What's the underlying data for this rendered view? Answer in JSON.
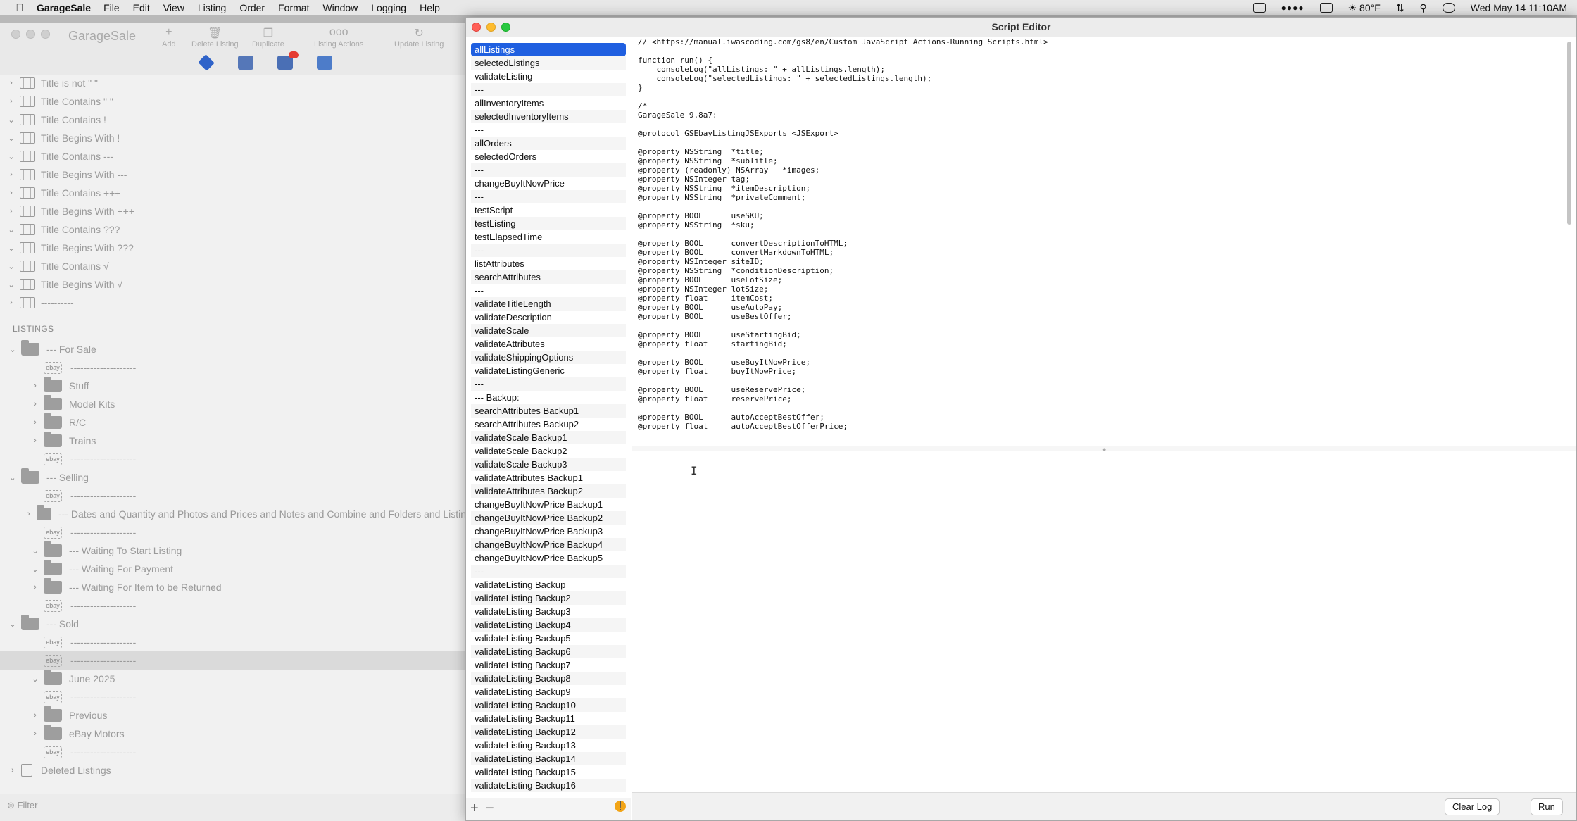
{
  "menubar": {
    "app_name": "GarageSale",
    "items": [
      "File",
      "Edit",
      "View",
      "Listing",
      "Order",
      "Format",
      "Window",
      "Logging",
      "Help"
    ],
    "weather": "80°F",
    "datetime": "Wed May 14 11:10AM"
  },
  "main": {
    "window_title": "GarageSale",
    "toolbar": {
      "add": "Add",
      "delete_listing": "Delete Listing",
      "duplicate": "Duplicate",
      "listing_actions": "Listing Actions",
      "update_listing": "Update Listing"
    },
    "smart_folders": [
      "Title is not \" \"",
      "Title Contains \" \"",
      "Title Contains !",
      "Title Begins With !",
      "Title Contains ---",
      "Title Begins With ---",
      "Title Contains +++",
      "Title Begins With +++",
      "Title Contains ???",
      "Title Begins With ???",
      "Title Contains √",
      "Title Begins With √",
      "----------"
    ],
    "section_listings": "LISTINGS",
    "listings": [
      {
        "label": "--- For Sale",
        "kind": "folder",
        "indent": 0
      },
      {
        "label": "--------------------",
        "kind": "ebay",
        "indent": 1
      },
      {
        "label": "Stuff",
        "kind": "folder",
        "indent": 1
      },
      {
        "label": "Model Kits",
        "kind": "folder",
        "indent": 1
      },
      {
        "label": "R/C",
        "kind": "folder",
        "indent": 1
      },
      {
        "label": "Trains",
        "kind": "folder",
        "indent": 1
      },
      {
        "label": "--------------------",
        "kind": "ebay",
        "indent": 1
      },
      {
        "label": "--- Selling",
        "kind": "folder",
        "indent": 0
      },
      {
        "label": "--------------------",
        "kind": "ebay",
        "indent": 1
      },
      {
        "label": "--- Dates and Quantity and Photos and Prices and Notes and Combine and Folders and Listin",
        "kind": "folder",
        "indent": 1
      },
      {
        "label": "--------------------",
        "kind": "ebay",
        "indent": 1
      },
      {
        "label": "--- Waiting To Start Listing",
        "kind": "folder",
        "indent": 1
      },
      {
        "label": "--- Waiting For Payment",
        "kind": "folder",
        "indent": 1
      },
      {
        "label": "--- Waiting For Item to be Returned",
        "kind": "folder",
        "indent": 1
      },
      {
        "label": "--------------------",
        "kind": "ebay",
        "indent": 1
      },
      {
        "label": "--- Sold",
        "kind": "folder",
        "indent": 0
      },
      {
        "label": "--------------------",
        "kind": "ebay",
        "indent": 1
      },
      {
        "label": "--------------------",
        "kind": "ebay",
        "indent": 1
      },
      {
        "label": "June 2025",
        "kind": "folder",
        "indent": 1
      },
      {
        "label": "--------------------",
        "kind": "ebay",
        "indent": 1
      },
      {
        "label": "Previous",
        "kind": "folder",
        "indent": 1
      },
      {
        "label": "eBay Motors",
        "kind": "folder",
        "indent": 1
      },
      {
        "label": "--------------------",
        "kind": "ebay",
        "indent": 1
      },
      {
        "label": "Deleted Listings",
        "kind": "trash",
        "indent": 0
      }
    ],
    "filter_placeholder": "Filter"
  },
  "editor": {
    "title": "Script Editor",
    "scripts": [
      "allListings",
      "selectedListings",
      "validateListing",
      "---",
      "allInventoryItems",
      "selectedInventoryItems",
      "---",
      "allOrders",
      "selectedOrders",
      "---",
      "changeBuyItNowPrice",
      "---",
      "testScript",
      "testListing",
      "testElapsedTime",
      "---",
      "listAttributes",
      "searchAttributes",
      "---",
      "validateTitleLength",
      "validateDescription",
      "validateScale",
      "validateAttributes",
      "validateShippingOptions",
      "validateListingGeneric",
      "---",
      "--- Backup:",
      "searchAttributes Backup1",
      "searchAttributes Backup2",
      "validateScale Backup1",
      "validateScale Backup2",
      "validateScale Backup3",
      "validateAttributes Backup1",
      "validateAttributes Backup2",
      "changeBuyItNowPrice Backup1",
      "changeBuyItNowPrice Backup2",
      "changeBuyItNowPrice Backup3",
      "changeBuyItNowPrice Backup4",
      "changeBuyItNowPrice Backup5",
      "---",
      "validateListing Backup",
      "validateListing Backup2",
      "validateListing Backup3",
      "validateListing Backup4",
      "validateListing Backup5",
      "validateListing Backup6",
      "validateListing Backup7",
      "validateListing Backup8",
      "validateListing Backup9",
      "validateListing Backup10",
      "validateListing Backup11",
      "validateListing Backup12",
      "validateListing Backup13",
      "validateListing Backup14",
      "validateListing Backup15",
      "validateListing Backup16"
    ],
    "code_lines": [
      "// <https://manual.iwascoding.com/gs8/en/Custom_JavaScript_Actions-Running_Scripts.html>",
      "",
      "function run() {",
      "    consoleLog(\"allListings: \" + allListings.length);",
      "    consoleLog(\"selectedListings: \" + selectedListings.length);",
      "}",
      "",
      "/*",
      "GarageSale 9.8a7:",
      "",
      "@protocol GSEbayListingJSExports <JSExport>",
      "",
      "@property NSString  *title;",
      "@property NSString  *subTitle;",
      "@property (readonly) NSArray   *images;",
      "@property NSInteger tag;",
      "@property NSString  *itemDescription;",
      "@property NSString  *privateComment;",
      "",
      "@property BOOL      useSKU;",
      "@property NSString  *sku;",
      "",
      "@property BOOL      convertDescriptionToHTML;",
      "@property BOOL      convertMarkdownToHTML;",
      "@property NSInteger siteID;",
      "@property NSString  *conditionDescription;",
      "@property BOOL      useLotSize;",
      "@property NSInteger lotSize;",
      "@property float     itemCost;",
      "@property BOOL      useAutoPay;",
      "@property BOOL      useBestOffer;",
      "",
      "@property BOOL      useStartingBid;",
      "@property float     startingBid;",
      "",
      "@property BOOL      useBuyItNowPrice;",
      "@property float     buyItNowPrice;",
      "",
      "@property BOOL      useReservePrice;",
      "@property float     reservePrice;",
      "",
      "@property BOOL      autoAcceptBestOffer;",
      "@property float     autoAcceptBestOfferPrice;"
    ],
    "clear_log": "Clear Log",
    "run": "Run"
  }
}
